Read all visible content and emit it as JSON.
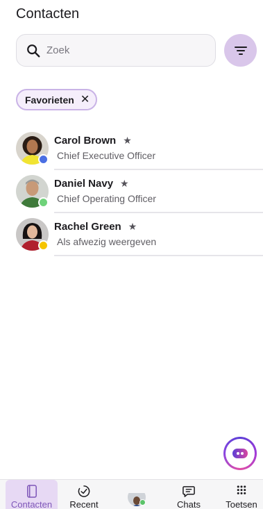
{
  "header": {
    "title": "Contacten"
  },
  "search": {
    "placeholder": "Zoek",
    "icon": "search-icon"
  },
  "filter_button": {
    "icon": "filter-icon",
    "color": "#d9c6ea"
  },
  "chip": {
    "label": "Favorieten",
    "close_glyph": "✕"
  },
  "contacts": [
    {
      "name": "Carol Brown",
      "subtitle": "Chief Executive Officer",
      "status_color": "#4a6fe3",
      "favorite_glyph": "★"
    },
    {
      "name": "Daniel Navy",
      "subtitle": "Chief Operating Officer",
      "status_color": "#6fd27a",
      "favorite_glyph": "★"
    },
    {
      "name": "Rachel Green",
      "subtitle": "Als afwezig weergeven",
      "status_color": "#f5c400",
      "favorite_glyph": "★"
    }
  ],
  "nav": {
    "items": [
      {
        "label": "Contacten",
        "icon": "contacts-book-icon",
        "active": true
      },
      {
        "label": "Recent",
        "icon": "recent-check-icon",
        "active": false
      },
      {
        "label": "",
        "icon": "profile-avatar",
        "active": false
      },
      {
        "label": "Chats",
        "icon": "chat-bubble-icon",
        "active": false
      },
      {
        "label": "Toetsen",
        "icon": "dialpad-icon",
        "active": false
      }
    ]
  },
  "colors": {
    "accent": "#7e56b8",
    "chip_border": "#c9b3e6"
  }
}
